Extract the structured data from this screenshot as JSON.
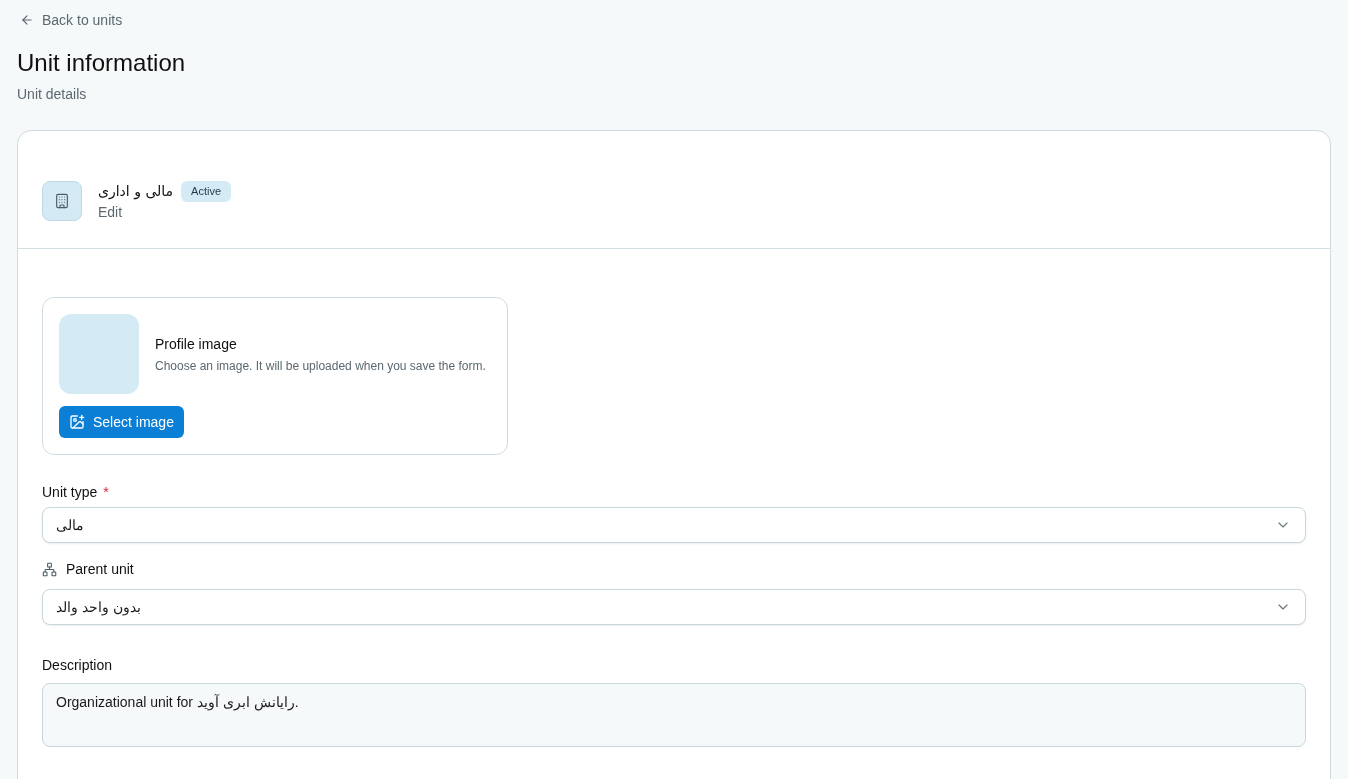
{
  "back_link": {
    "label": "Back to units"
  },
  "page": {
    "title": "Unit information",
    "subtitle": "Unit details"
  },
  "unit": {
    "name": "مالی و اداری",
    "status": "Active",
    "action": "Edit"
  },
  "profile_image": {
    "title": "Profile image",
    "hint": "Choose an image. It will be uploaded when you save the form.",
    "button": "Select image"
  },
  "unit_type": {
    "label": "Unit type",
    "required_mark": "*",
    "value": "مالی"
  },
  "parent_unit": {
    "label": "Parent unit",
    "value": "بدون واحد والد"
  },
  "description": {
    "label": "Description",
    "value": "Organizational unit for رایانش ابری آوید."
  }
}
